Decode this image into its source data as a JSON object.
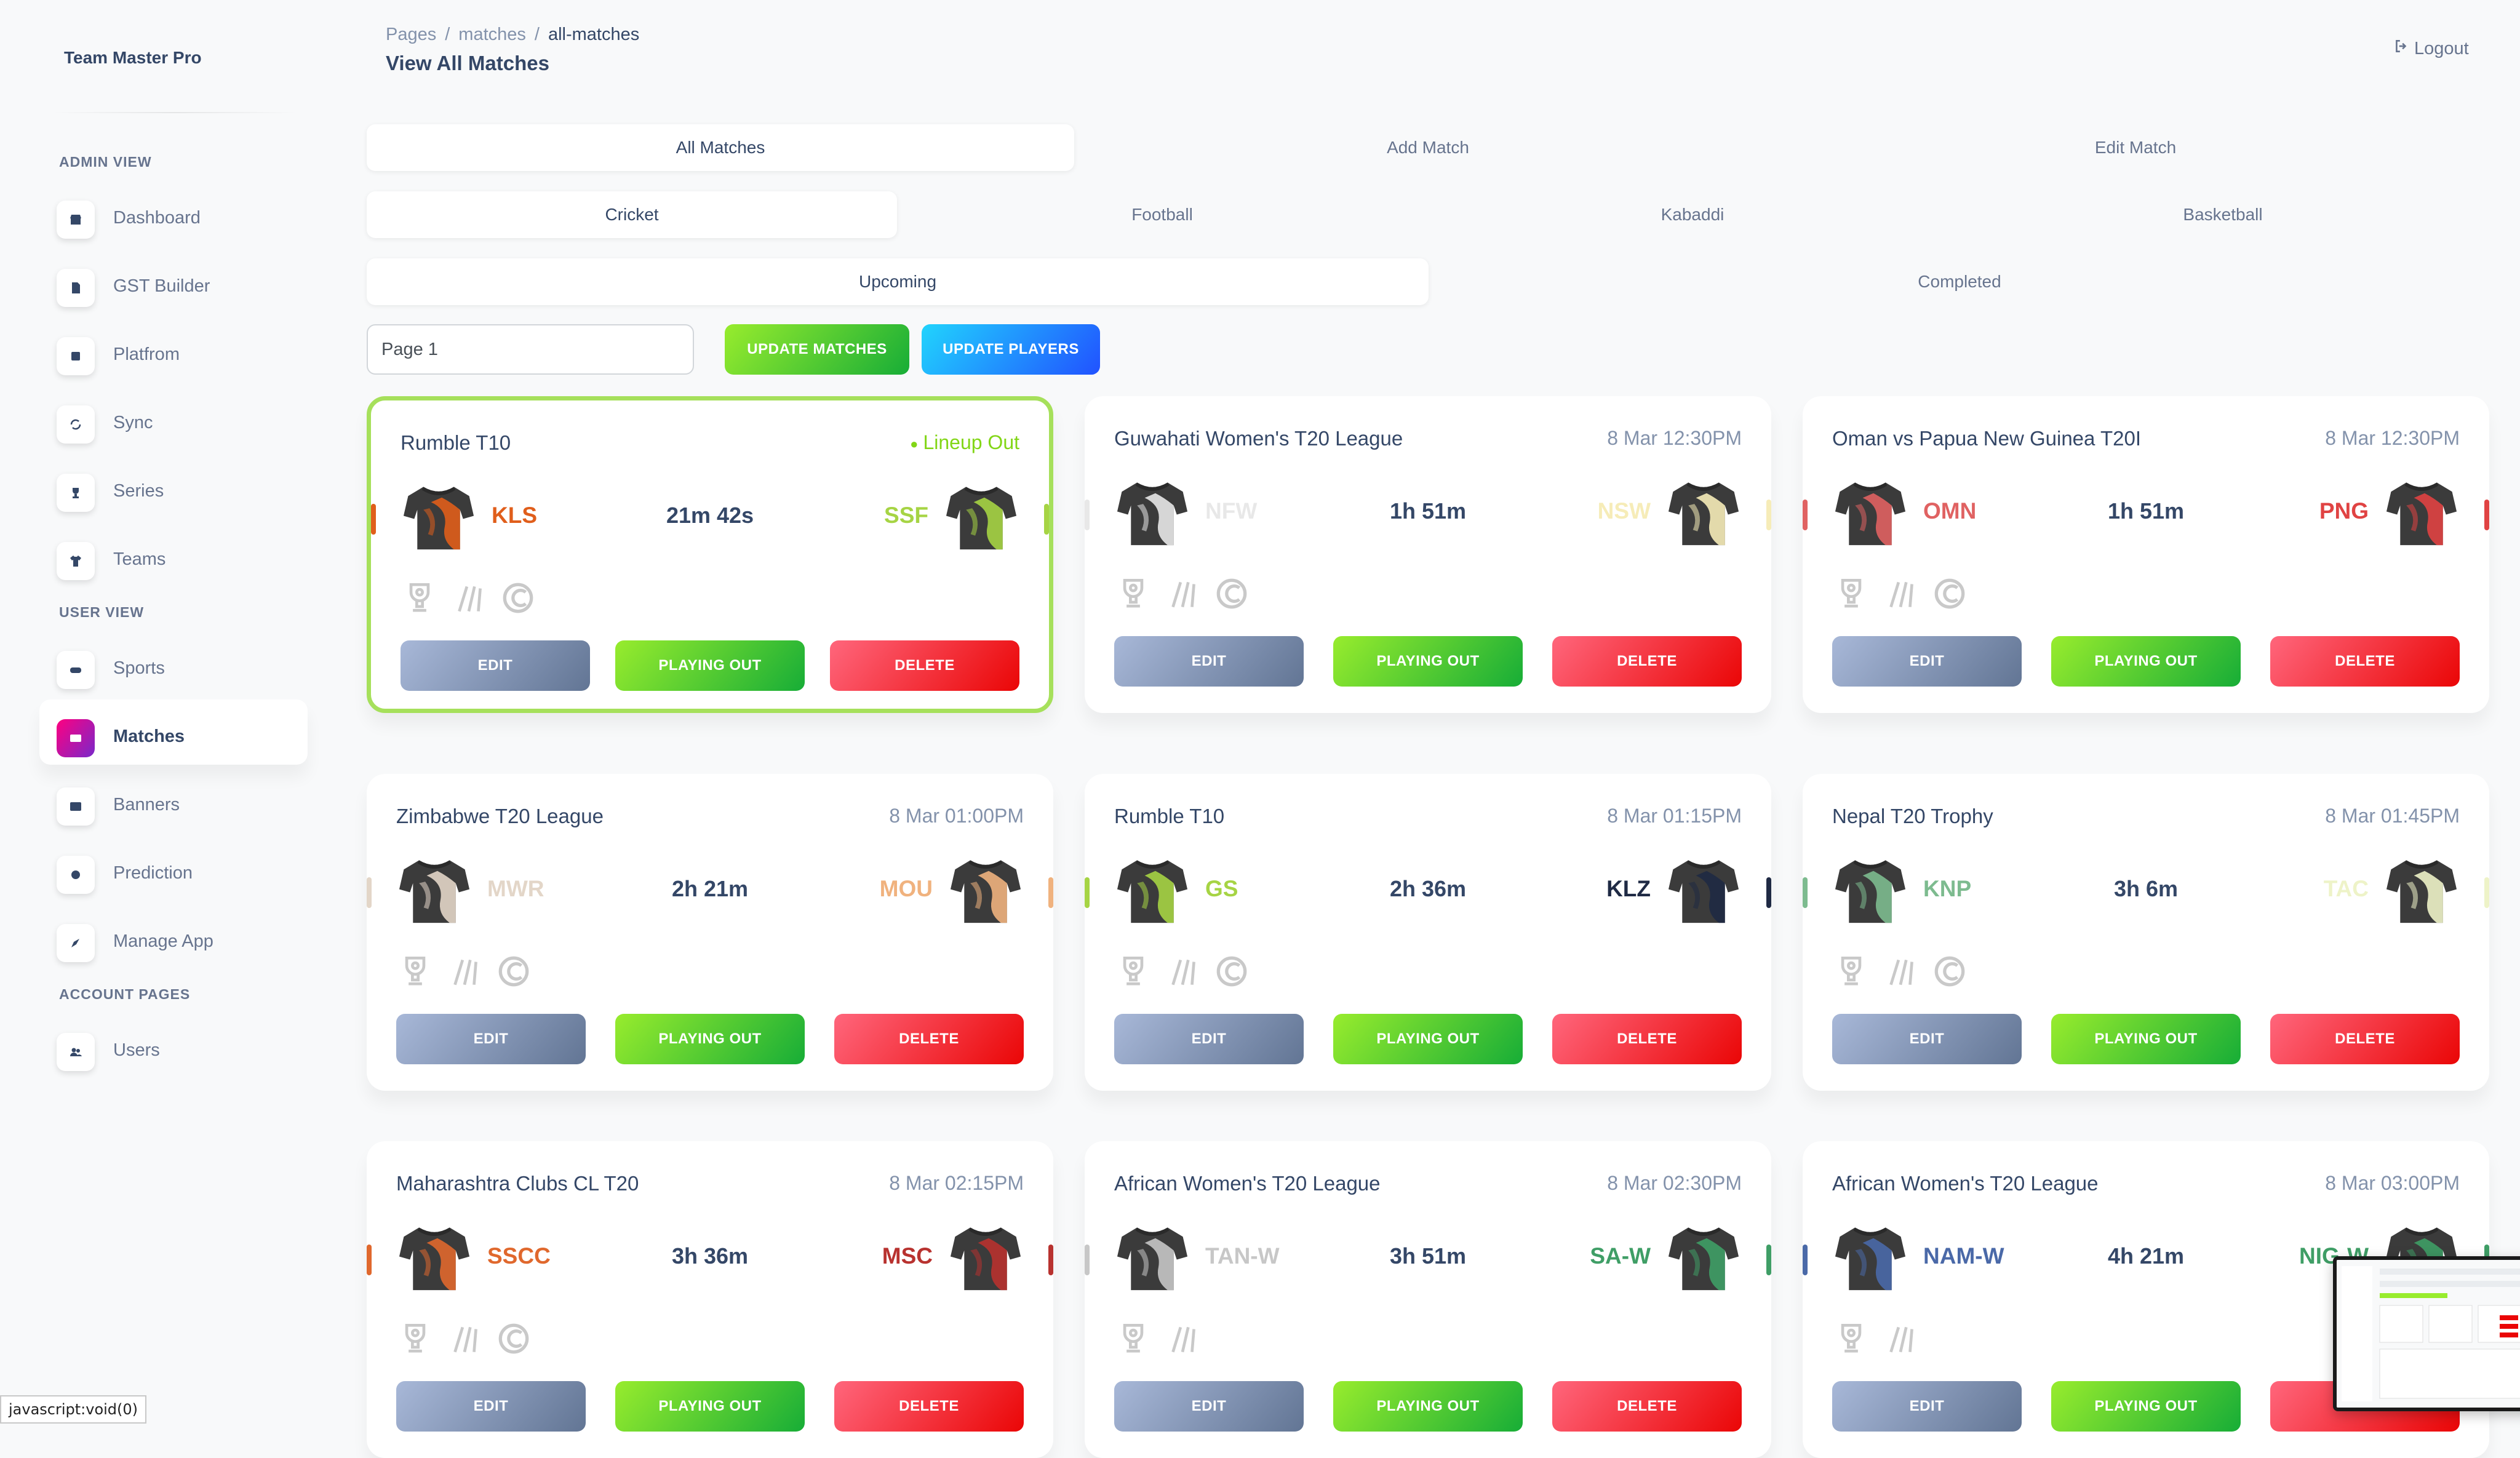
{
  "app": {
    "brand": "Team Master Pro"
  },
  "sidebar": {
    "sections": [
      {
        "title": "ADMIN VIEW",
        "items": [
          {
            "label": "Dashboard",
            "icon": "shop-icon"
          },
          {
            "label": "GST Builder",
            "icon": "document-icon"
          },
          {
            "label": "Platfrom",
            "icon": "box-icon"
          },
          {
            "label": "Sync",
            "icon": "sync-icon"
          },
          {
            "label": "Series",
            "icon": "trophy-icon"
          },
          {
            "label": "Teams",
            "icon": "shirt-icon"
          }
        ]
      },
      {
        "title": "USER VIEW",
        "items": [
          {
            "label": "Sports",
            "icon": "gamepad-icon"
          },
          {
            "label": "Matches",
            "icon": "ticket-icon",
            "active": true
          },
          {
            "label": "Banners",
            "icon": "image-icon"
          },
          {
            "label": "Prediction",
            "icon": "gear-icon"
          },
          {
            "label": "Manage App",
            "icon": "rocket-icon"
          }
        ]
      },
      {
        "title": "ACCOUNT PAGES",
        "items": [
          {
            "label": "Users",
            "icon": "users-icon"
          }
        ]
      }
    ]
  },
  "header": {
    "breadcrumb": [
      "Pages",
      "matches",
      "all-matches"
    ],
    "title": "View All Matches",
    "logout": "Logout"
  },
  "tabs": {
    "view": [
      "All Matches",
      "Add Match",
      "Edit Match"
    ],
    "sport": [
      "Cricket",
      "Football",
      "Kabaddi",
      "Basketball"
    ],
    "status": [
      "Upcoming",
      "Completed"
    ]
  },
  "controls": {
    "page_value": "Page 1",
    "update_matches": "UPDATE MATCHES",
    "update_players": "UPDATE PLAYERS"
  },
  "card_actions": {
    "edit": "EDIT",
    "playing_out": "PLAYING OUT",
    "delete": "DELETE"
  },
  "colors": {
    "accent_green": "#82d616",
    "edit_btn": "#8392ab",
    "delete_btn": "#ea0606"
  },
  "matches": [
    {
      "league": "Rumble T10",
      "time": "Lineup Out",
      "lineup": true,
      "home": "KLS",
      "away": "SSF",
      "countdown": "21m 42s",
      "home_color": "#e05e1b",
      "away_color": "#a6d444",
      "highlight": true,
      "icons": 3
    },
    {
      "league": "Guwahati Women's T20 League",
      "time": "8 Mar 12:30PM",
      "home": "NFW",
      "away": "NSW",
      "countdown": "1h 51m",
      "home_color": "#e8e8e8",
      "away_color": "#f6ecb8",
      "icons": 3
    },
    {
      "league": "Oman vs Papua New Guinea T20I",
      "time": "8 Mar 12:30PM",
      "home": "OMN",
      "away": "PNG",
      "countdown": "1h 51m",
      "home_color": "#e06262",
      "away_color": "#e04343",
      "icons": 3
    },
    {
      "league": "Zimbabwe T20 League",
      "time": "8 Mar 01:00PM",
      "home": "MWR",
      "away": "MOU",
      "countdown": "2h 21m",
      "home_color": "#e3d6c8",
      "away_color": "#f0b27e",
      "icons": 3
    },
    {
      "league": "Rumble T10",
      "time": "8 Mar 01:15PM",
      "home": "GS",
      "away": "KLZ",
      "countdown": "2h 36m",
      "home_color": "#a6d444",
      "away_color": "#1f2a44",
      "icons": 3
    },
    {
      "league": "Nepal T20 Trophy",
      "time": "8 Mar 01:45PM",
      "home": "KNP",
      "away": "TAC",
      "countdown": "3h 6m",
      "home_color": "#7dbb8f",
      "away_color": "#eef3c8",
      "icons": 3
    },
    {
      "league": "Maharashtra Clubs CL T20",
      "time": "8 Mar 02:15PM",
      "home": "SSCC",
      "away": "MSC",
      "countdown": "3h 36m",
      "home_color": "#e0682d",
      "away_color": "#b8322f",
      "icons": 3
    },
    {
      "league": "African Women's T20 League",
      "time": "8 Mar 02:30PM",
      "home": "TAN-W",
      "away": "SA-W",
      "countdown": "3h 51m",
      "home_color": "#c7c7c7",
      "away_color": "#3f9e66",
      "icons": 2
    },
    {
      "league": "African Women's T20 League",
      "time": "8 Mar 03:00PM",
      "home": "NAM-W",
      "away": "NIG-W",
      "countdown": "4h 21m",
      "home_color": "#4a69a8",
      "away_color": "#3f9e66",
      "icons": 2
    }
  ],
  "statusbar": "javascript:void(0)"
}
